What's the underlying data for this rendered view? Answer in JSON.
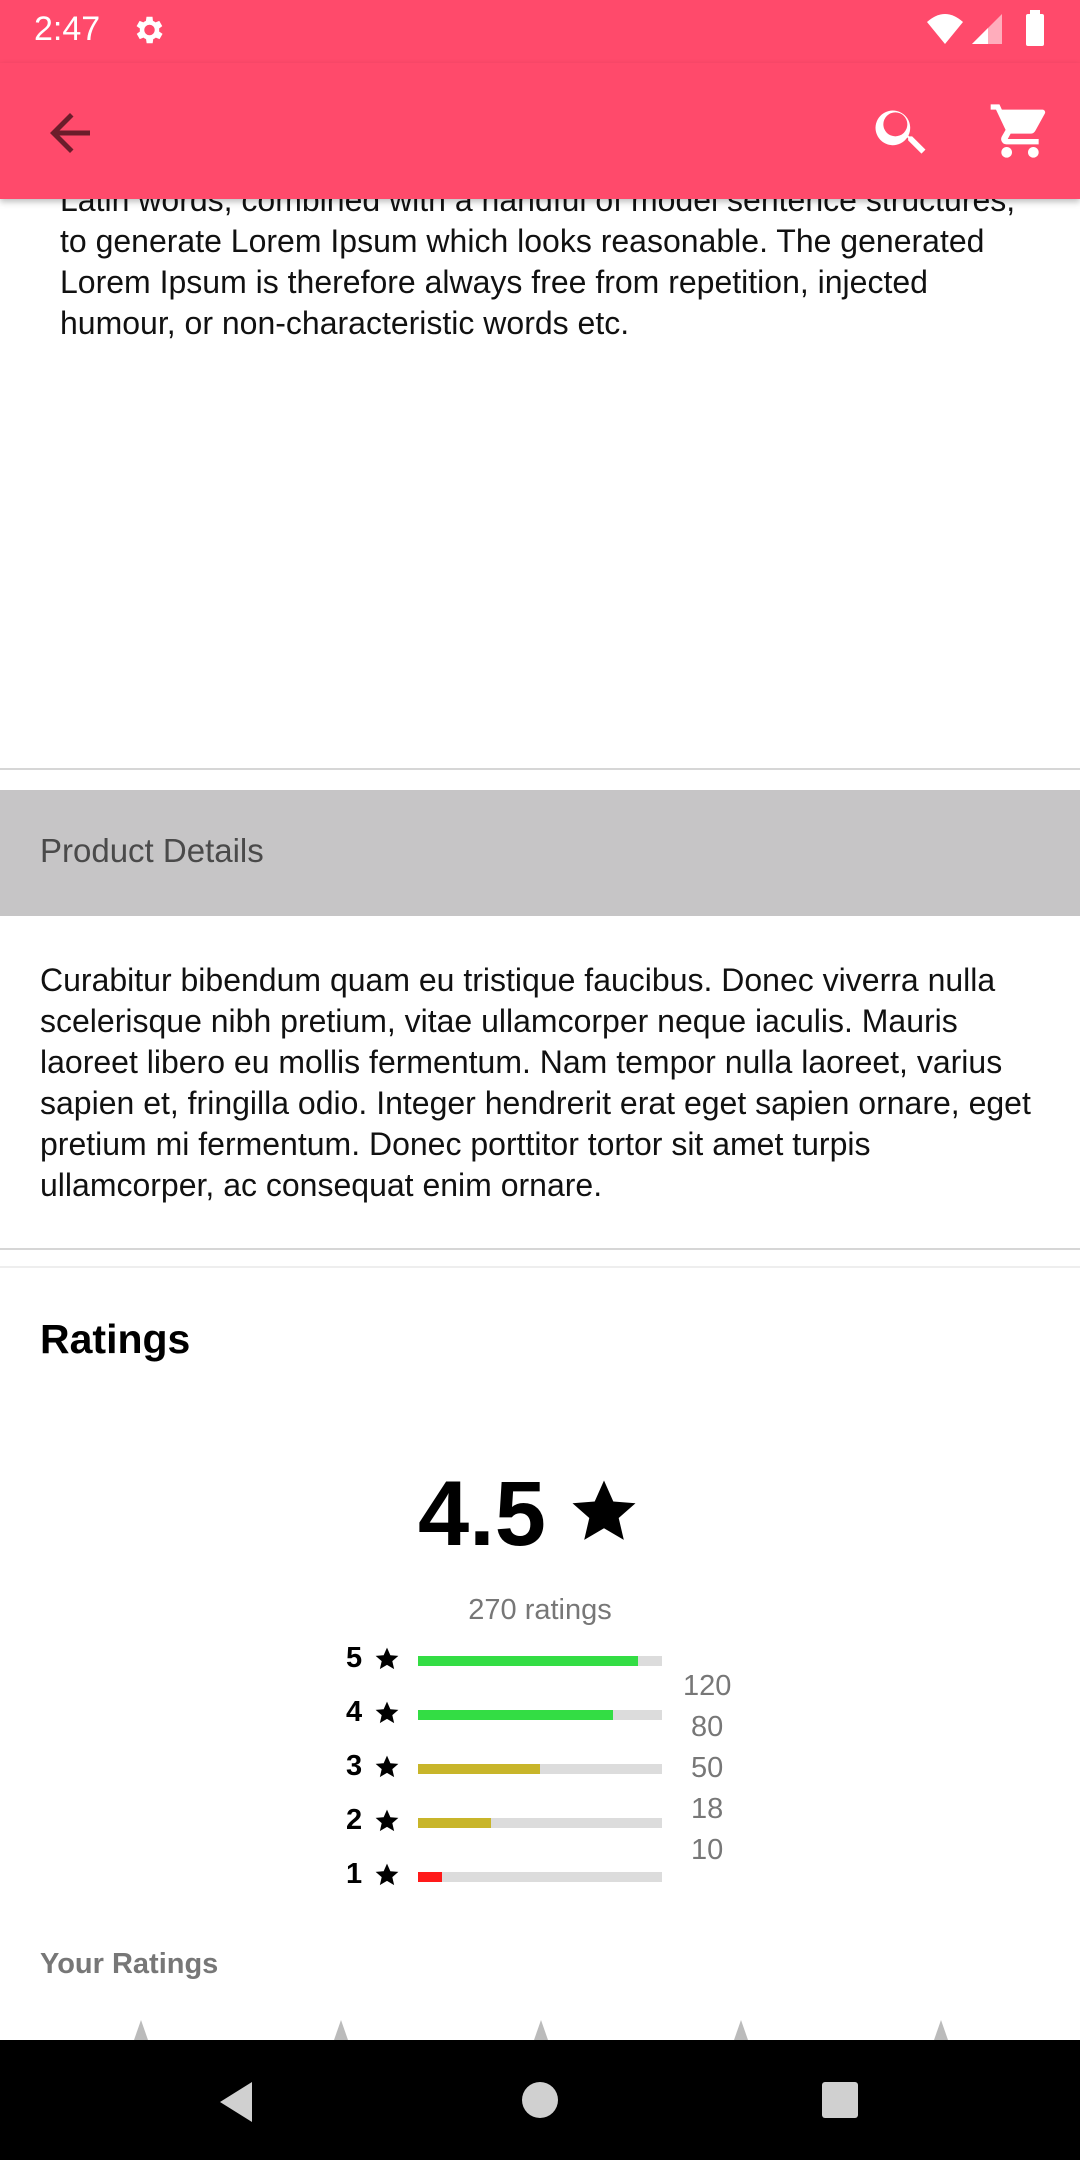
{
  "status_bar": {
    "time": "2:47"
  },
  "description_text": "Latin words, combined with a handful of model sentence structures, to generate Lorem Ipsum which looks reasonable. The generated Lorem Ipsum is therefore always free from repetition, injected humour, or non-characteristic words etc.",
  "product_details": {
    "header": "Product Details",
    "body": "Curabitur bibendum quam eu tristique faucibus. Donec viverra nulla scelerisque nibh pretium, vitae ullamcorper neque iaculis. Mauris laoreet libero eu mollis fermentum. Nam tempor nulla laoreet, varius sapien et, fringilla odio. Integer hendrerit erat eget sapien ornare, eget pretium mi fermentum. Donec porttitor tortor sit amet turpis ullamcorper, ac consequat enim ornare."
  },
  "ratings": {
    "title": "Ratings",
    "average": "4.5",
    "count_text": "270 ratings",
    "breakdown": [
      {
        "stars": "5",
        "count": "120",
        "fill_fraction": 0.9,
        "color": "#33dd44"
      },
      {
        "stars": "4",
        "count": "80",
        "fill_fraction": 0.8,
        "color": "#33dd44"
      },
      {
        "stars": "3",
        "count": "50",
        "fill_fraction": 0.5,
        "color": "#c8b52a"
      },
      {
        "stars": "2",
        "count": "18",
        "fill_fraction": 0.3,
        "color": "#c8b52a"
      },
      {
        "stars": "1",
        "count": "10",
        "fill_fraction": 0.1,
        "color": "#ff1a1a"
      }
    ],
    "your_ratings_label": "Your Ratings"
  },
  "colors": {
    "app_bar": "#ff4a6b",
    "section_header": "#c6c5c6"
  },
  "icons": {
    "back": "arrow-left-icon",
    "search": "search-icon",
    "cart": "shopping-cart-icon"
  }
}
